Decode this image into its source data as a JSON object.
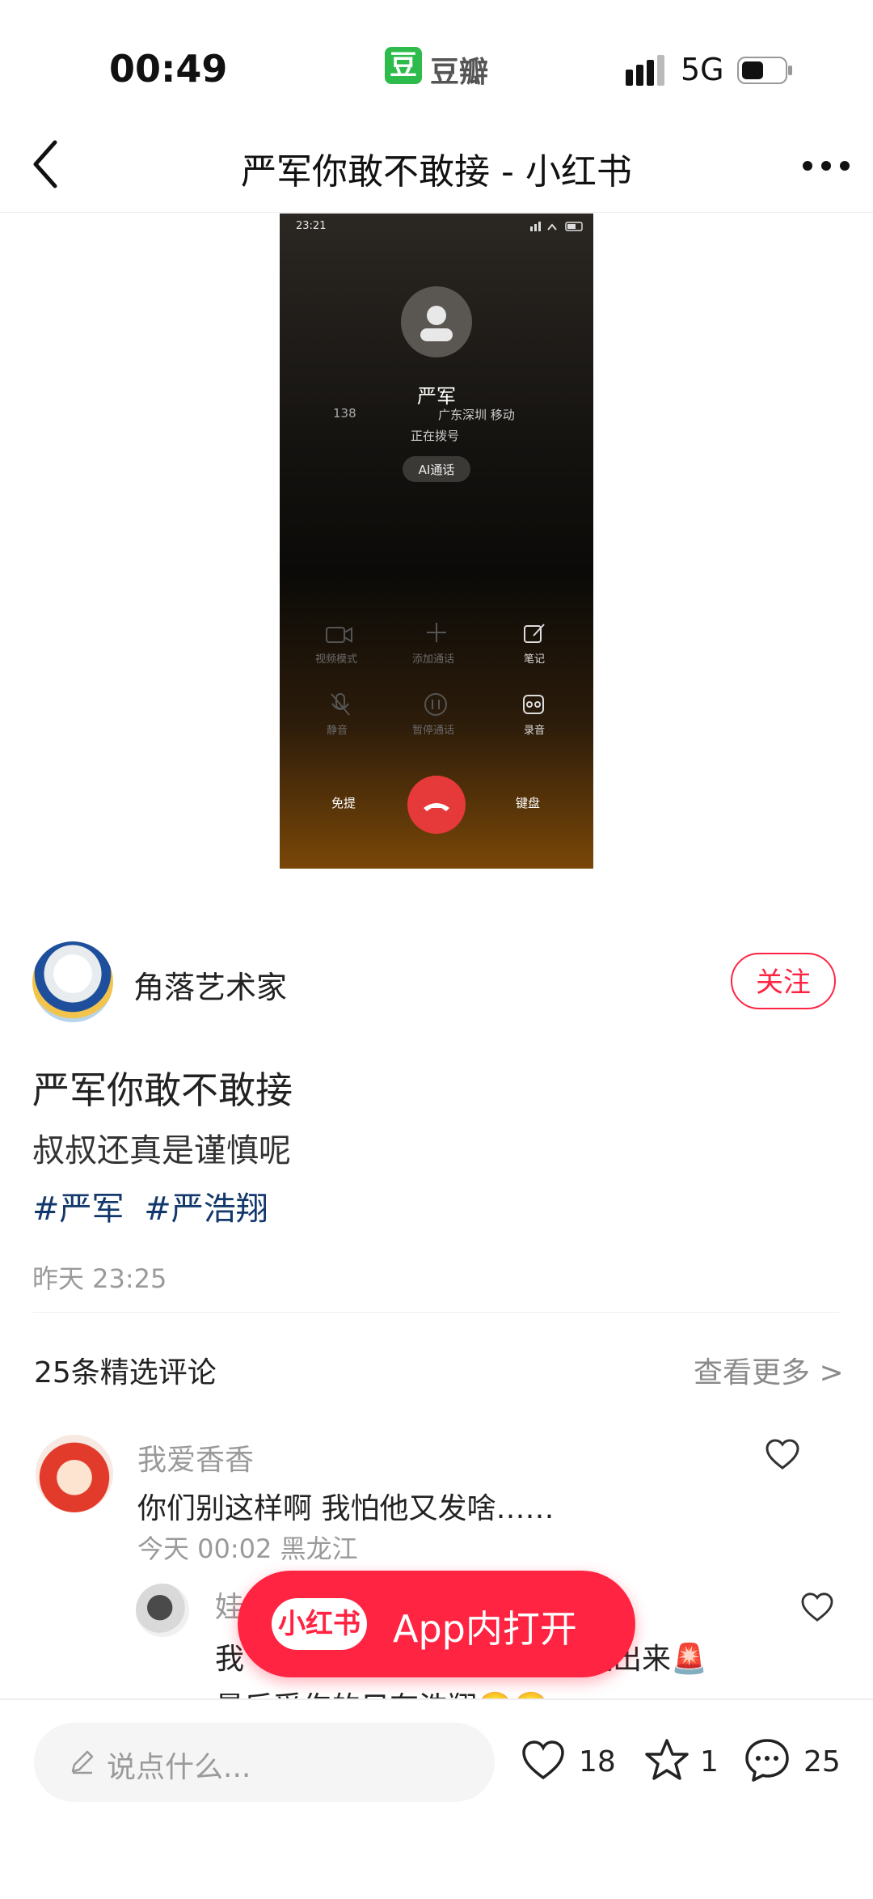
{
  "status_bar": {
    "time": "00:49",
    "app_badge": "豆",
    "app_name": "豆瓣",
    "network": "5G"
  },
  "nav": {
    "title": "严军你敢不敢接 - 小红书"
  },
  "embedded_screenshot": {
    "time": "23:21",
    "caller_name": "严军",
    "number_partial": "138",
    "location": "广东深圳 移动",
    "status": "正在拨号",
    "ai_button": "AI通话",
    "buttons_row1": [
      "视频模式",
      "添加通话",
      "笔记"
    ],
    "buttons_row2": [
      "静音",
      "暂停通话",
      "录音"
    ],
    "speaker_label": "免提",
    "keypad_label": "键盘"
  },
  "author": {
    "name": "角落艺术家",
    "follow_label": "关注"
  },
  "post": {
    "title": "严军你敢不敢接",
    "description": "叔叔还真是谨慎呢",
    "tags": [
      "#严军",
      "#严浩翔"
    ],
    "time": "昨天 23:25"
  },
  "comments_header": {
    "count_label": "25条精选评论",
    "see_more": "查看更多 >"
  },
  "comments": [
    {
      "name": "我爱香香",
      "text": "你们别这样啊 我怕他又发啥……",
      "meta": "今天 00:02 黑龙江"
    },
    {
      "name": "娃",
      "text": "我",
      "text_tail": "发出来🚨",
      "text2": "最后受伤的只有浩翔🥺🥺"
    }
  ],
  "open_app": {
    "logo": "小红书",
    "label": "App内打开"
  },
  "bottom_bar": {
    "placeholder": "说点什么...",
    "likes": "18",
    "collects": "1",
    "comments": "25"
  },
  "colors": {
    "accent": "#ff2442",
    "tag": "#13386c",
    "douban": "#2dbb4b"
  }
}
